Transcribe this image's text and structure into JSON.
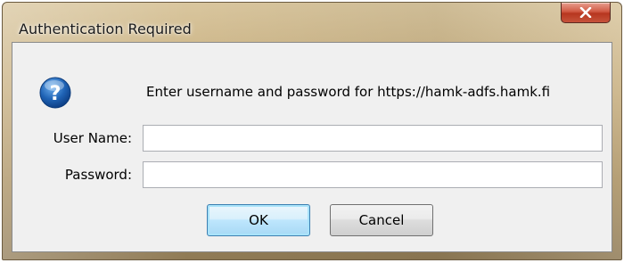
{
  "window": {
    "title": "Authentication Required",
    "close_glyph": "x"
  },
  "dialog": {
    "icon": "question-icon",
    "message": "Enter username and password for https://hamk-adfs.hamk.fi",
    "username": {
      "label": "User Name:",
      "value": "",
      "placeholder": ""
    },
    "password": {
      "label": "Password:",
      "value": "",
      "placeholder": ""
    },
    "buttons": {
      "ok": "OK",
      "cancel": "Cancel"
    }
  },
  "colors": {
    "accent": "#3c7fb1",
    "close": "#c6533b",
    "icon_blue": "#1f63b5"
  }
}
